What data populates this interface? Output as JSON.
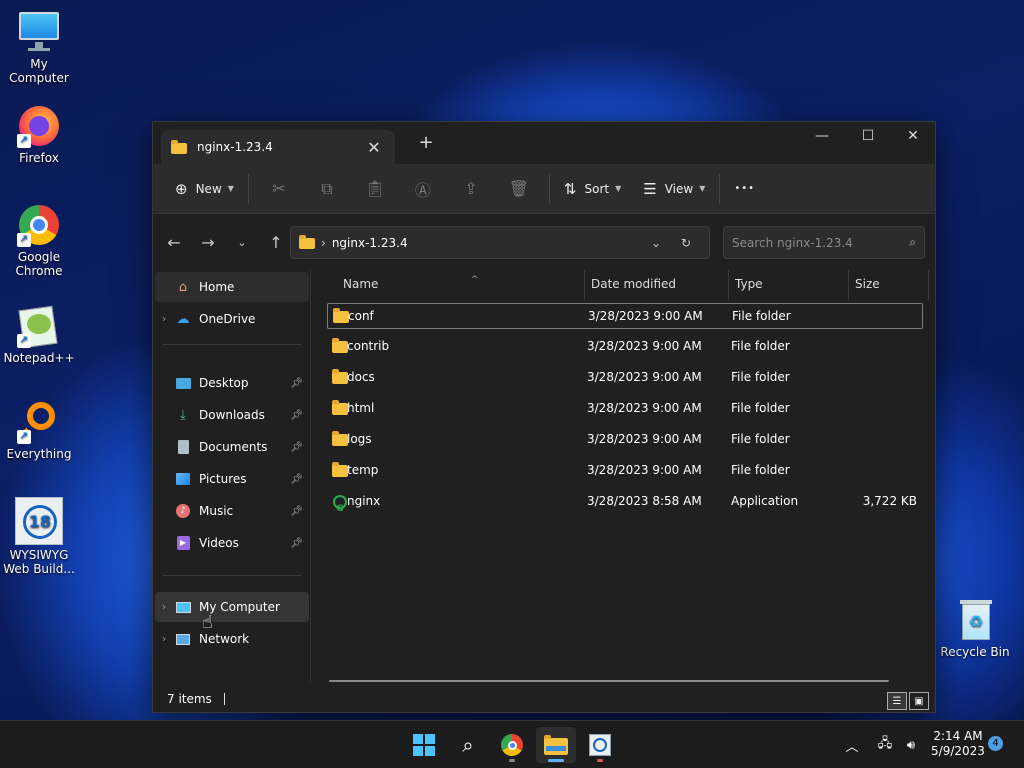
{
  "desktop": {
    "icons": [
      {
        "label": "My Computer",
        "icon": "monitor-icon"
      },
      {
        "label": "Firefox",
        "icon": "firefox-icon"
      },
      {
        "label": "Google Chrome",
        "icon": "chrome-icon"
      },
      {
        "label": "Notepad++",
        "icon": "notepad-plus-plus-icon"
      },
      {
        "label": "Everything",
        "icon": "everything-search-icon"
      },
      {
        "label": "WYSIWYG Web Build...",
        "icon": "wysiwyg-icon",
        "badge": "18"
      },
      {
        "label": "Recycle Bin",
        "icon": "recycle-bin-icon"
      }
    ]
  },
  "window": {
    "tab_title": "nginx-1.23.4",
    "new_tab": "+",
    "controls": {
      "minimize": "—",
      "maximize": "☐",
      "close": "✕"
    },
    "toolbar": {
      "new_label": "New",
      "sort_label": "Sort",
      "view_label": "View",
      "more_label": "•••"
    },
    "address": {
      "path": "nginx-1.23.4",
      "search_placeholder": "Search nginx-1.23.4"
    },
    "sidebar": {
      "home": "Home",
      "onedrive": "OneDrive",
      "quick": [
        {
          "label": "Desktop"
        },
        {
          "label": "Downloads"
        },
        {
          "label": "Documents"
        },
        {
          "label": "Pictures"
        },
        {
          "label": "Music"
        },
        {
          "label": "Videos"
        }
      ],
      "my_computer": "My Computer",
      "network": "Network"
    },
    "columns": {
      "name": "Name",
      "date": "Date modified",
      "type": "Type",
      "size": "Size"
    },
    "files": [
      {
        "name": "conf",
        "date": "3/28/2023 9:00 AM",
        "type": "File folder",
        "size": ""
      },
      {
        "name": "contrib",
        "date": "3/28/2023 9:00 AM",
        "type": "File folder",
        "size": ""
      },
      {
        "name": "docs",
        "date": "3/28/2023 9:00 AM",
        "type": "File folder",
        "size": ""
      },
      {
        "name": "html",
        "date": "3/28/2023 9:00 AM",
        "type": "File folder",
        "size": ""
      },
      {
        "name": "logs",
        "date": "3/28/2023 9:00 AM",
        "type": "File folder",
        "size": ""
      },
      {
        "name": "temp",
        "date": "3/28/2023 9:00 AM",
        "type": "File folder",
        "size": ""
      },
      {
        "name": "nginx",
        "date": "3/28/2023 8:58 AM",
        "type": "Application",
        "size": "3,722 KB"
      }
    ],
    "status": {
      "count": "7 items"
    }
  },
  "taskbar": {
    "time": "2:14 AM",
    "date": "5/9/2023",
    "notification_count": "4"
  },
  "colors": {
    "accent": "#5fb2ff",
    "folder": "#f5c13e",
    "window_bg": "#202020"
  }
}
